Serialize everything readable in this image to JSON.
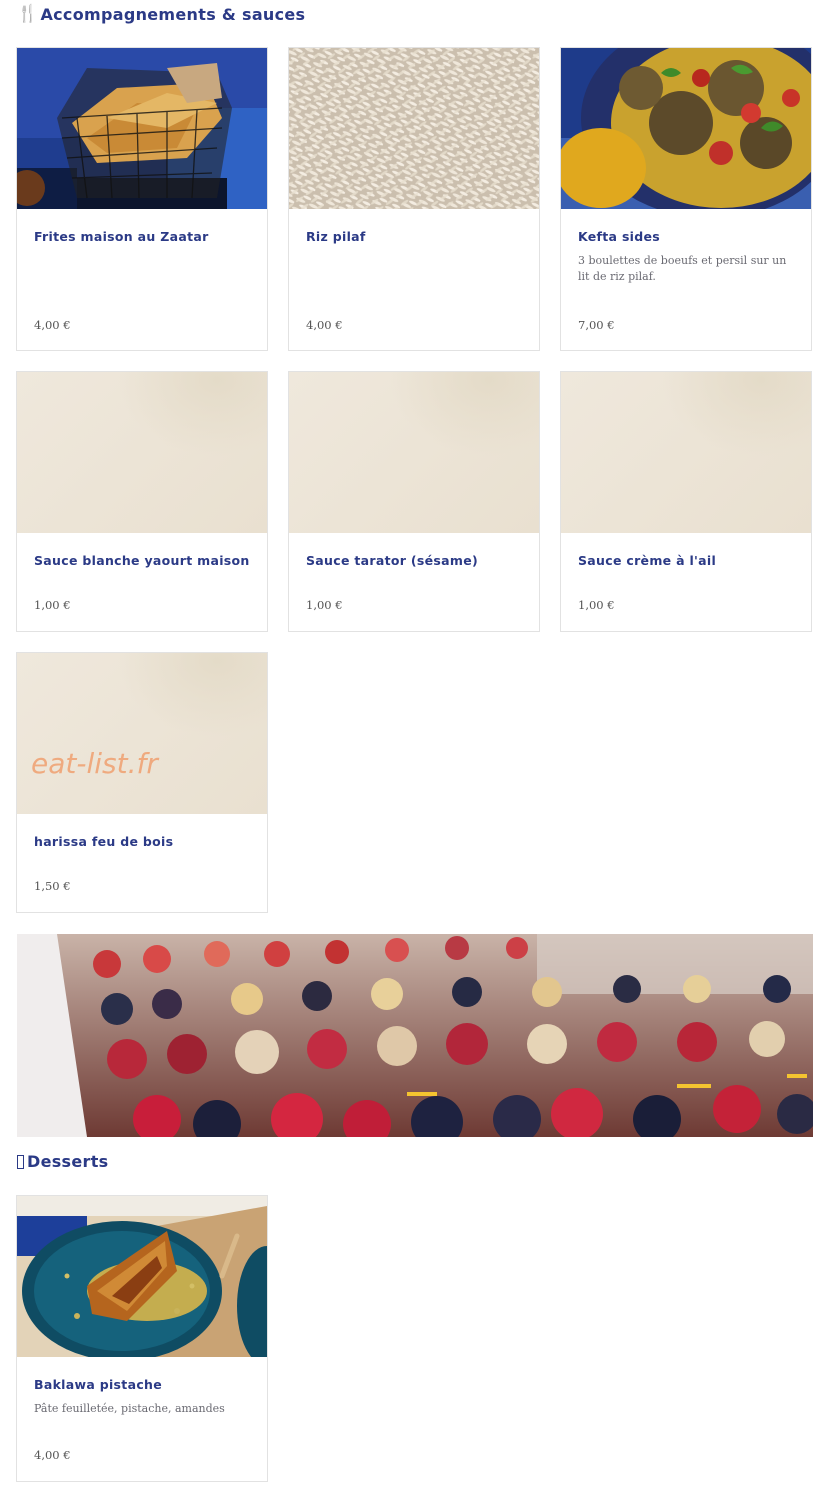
{
  "sections": {
    "sides": {
      "title": "Accompagnements & sauces",
      "icon": "fork-knife-icon"
    },
    "desserts": {
      "title": "Desserts",
      "icon": "missing-glyph-icon"
    }
  },
  "items": [
    {
      "name": "Frites maison au Zaatar",
      "description": "",
      "price": "4,00 €"
    },
    {
      "name": "Riz pilaf",
      "description": "",
      "price": "4,00 €"
    },
    {
      "name": "Kefta sides",
      "description": "3 boulettes de boeufs et persil sur un lit de riz pilaf.",
      "price": "7,00 €"
    },
    {
      "name": "Sauce blanche yaourt maison",
      "description": "",
      "price": "1,00 €"
    },
    {
      "name": "Sauce tarator (sésame)",
      "description": "",
      "price": "1,00 €"
    },
    {
      "name": "Sauce crème à l'ail",
      "description": "",
      "price": "1,00 €"
    },
    {
      "name": "harissa feu de bois",
      "description": "",
      "price": "1,50 €"
    },
    {
      "name": "Baklawa pistache",
      "description": "Pâte feuilletée, pistache, amandes",
      "price": "4,00 €"
    }
  ],
  "watermark": "eat-list.fr",
  "colors": {
    "heading": "#2b3a86",
    "price": "#555555",
    "description": "#6a6a72",
    "watermark": "#f0a070"
  }
}
